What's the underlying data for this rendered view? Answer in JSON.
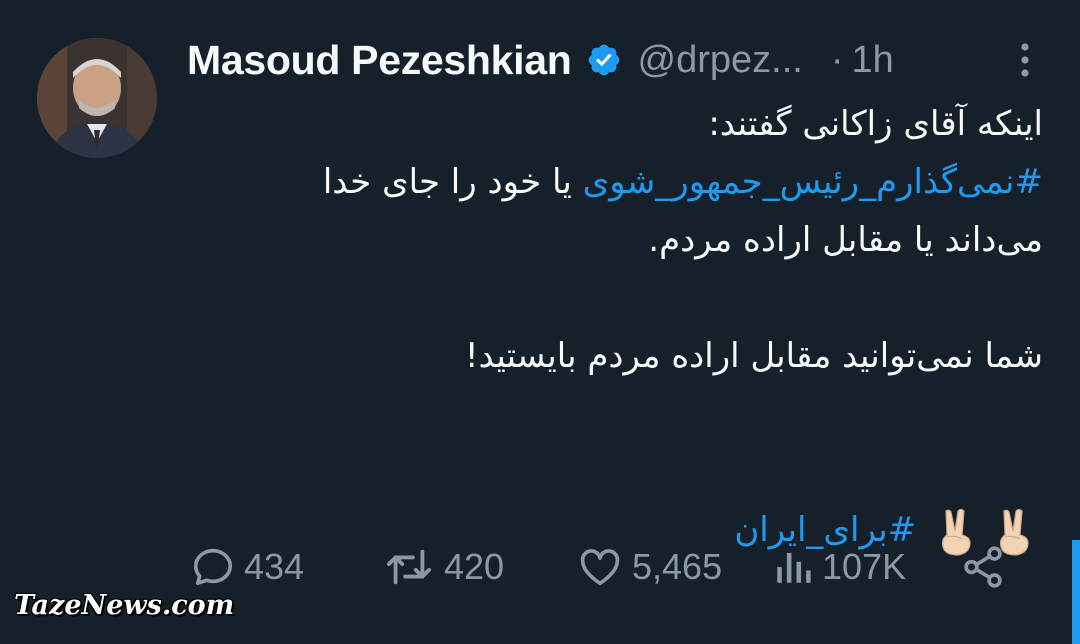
{
  "author": {
    "name": "Masoud Pezeshkian",
    "handle": "@drpez...",
    "separator": "·",
    "time": "1h",
    "verified": true
  },
  "tweet": {
    "line1": "اینکه آقای زاکانی گفتند:",
    "hashtag1": "#نمی‌گذارم_رئیس_جمهور_شوی",
    "line2_tail": " یا خود را جای خدا",
    "line3": "می‌داند یا مقابل اراده مردم.",
    "line4": "شما نمی‌توانید مقابل اراده مردم بایستید!",
    "hashtag2": "#برای_ایران"
  },
  "actions": {
    "replies": "434",
    "retweets": "420",
    "likes": "5,465",
    "views": "107K"
  },
  "icons": {
    "reply": "reply-icon",
    "retweet": "retweet-icon",
    "like": "heart-icon",
    "views": "views-icon",
    "share": "share-icon",
    "more": "more-icon",
    "verified": "verified-badge-icon",
    "victory": "victory-hand-emoji"
  },
  "watermark": "TazeNews.com",
  "colors": {
    "background": "#15202b",
    "accent": "#1d9bf0",
    "secondary_text": "#8b98a5"
  }
}
